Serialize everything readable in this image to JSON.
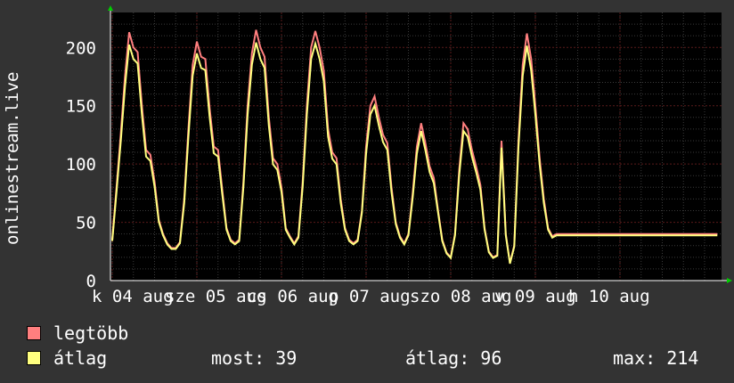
{
  "chart_data": {
    "type": "line",
    "ylabel": "onlinestream.live",
    "ylim": [
      0,
      230
    ],
    "yticks": [
      0,
      50,
      100,
      150,
      200
    ],
    "grid": true,
    "x_tick_labels": [
      "k 04 aug",
      "sze 05 aug",
      "cs 06 aug",
      "p 07 aug",
      "szo 08 aug",
      "v 09 aug",
      "h 10 aug"
    ],
    "colors": {
      "background": "#333333",
      "plot": "#000000",
      "grid": "#5a1a1a",
      "max": "#ff7f7f",
      "avg": "#ffff7f",
      "axis_arrow": "#00cc00"
    },
    "series": [
      {
        "name": "legtöbb",
        "x": [
          0,
          0.05,
          0.1,
          0.15,
          0.2,
          0.25,
          0.3,
          0.35,
          0.4,
          0.45,
          0.5,
          0.55,
          0.6,
          0.65,
          0.7,
          0.75,
          0.8,
          0.85,
          0.9,
          0.95,
          1.0,
          1.05,
          1.1,
          1.15,
          1.2,
          1.25,
          1.3,
          1.35,
          1.4,
          1.45,
          1.5,
          1.55,
          1.6,
          1.65,
          1.7,
          1.75,
          1.8,
          1.85,
          1.9,
          1.95,
          2.0,
          2.05,
          2.1,
          2.15,
          2.2,
          2.25,
          2.3,
          2.35,
          2.4,
          2.45,
          2.5,
          2.55,
          2.6,
          2.65,
          2.7,
          2.75,
          2.8,
          2.85,
          2.9,
          2.95,
          3.0,
          3.05,
          3.1,
          3.15,
          3.2,
          3.25,
          3.3,
          3.35,
          3.4,
          3.45,
          3.5,
          3.55,
          3.6,
          3.65,
          3.7,
          3.75,
          3.8,
          3.85,
          3.9,
          3.95,
          4.0,
          4.05,
          4.1,
          4.15,
          4.2,
          4.25,
          4.3,
          4.35,
          4.4,
          4.45,
          4.5,
          4.55,
          4.6,
          4.65,
          4.7,
          4.75,
          4.8,
          4.85,
          4.9,
          4.95,
          5.0,
          5.05,
          5.1,
          5.15,
          5.2,
          5.25,
          5.3,
          5.35,
          5.4,
          5.45,
          5.5,
          5.55,
          5.6,
          5.65,
          5.68,
          5.7,
          5.72,
          5.75,
          5.8,
          5.85,
          5.9,
          5.95,
          6.0,
          6.05,
          6.1,
          6.15,
          6.2,
          6.25,
          6.3,
          6.35,
          6.4,
          6.45,
          6.5,
          6.55,
          6.6,
          6.65,
          6.7,
          6.75,
          6.8,
          6.85,
          6.9,
          6.95,
          7.0,
          7.05,
          7.1,
          7.15
        ],
        "values": [
          35,
          80,
          125,
          175,
          213,
          200,
          196,
          150,
          112,
          108,
          85,
          52,
          40,
          32,
          28,
          28,
          33,
          70,
          130,
          185,
          205,
          192,
          190,
          148,
          115,
          112,
          78,
          45,
          35,
          32,
          35,
          85,
          150,
          195,
          215,
          200,
          192,
          140,
          105,
          100,
          80,
          45,
          38,
          32,
          38,
          85,
          150,
          200,
          214,
          200,
          180,
          130,
          110,
          105,
          70,
          45,
          35,
          32,
          35,
          60,
          115,
          150,
          158,
          140,
          125,
          118,
          80,
          50,
          38,
          32,
          40,
          75,
          115,
          135,
          118,
          98,
          88,
          60,
          35,
          24,
          20,
          40,
          95,
          135,
          130,
          112,
          98,
          82,
          45,
          25,
          20,
          22,
          120,
          40,
          15,
          30,
          120,
          185,
          212,
          190,
          150,
          105,
          70,
          45,
          38,
          40,
          40,
          40,
          40,
          40,
          40,
          40,
          40,
          40,
          40,
          40,
          40,
          40,
          40,
          40,
          40,
          40,
          40,
          40,
          40,
          40,
          40,
          40,
          40,
          40,
          40,
          40,
          40,
          40,
          40,
          40,
          40,
          40,
          40,
          40,
          40,
          40,
          40,
          40,
          40,
          40
        ]
      },
      {
        "name": "átlag",
        "x": [],
        "values": []
      }
    ]
  },
  "legend": [
    {
      "label": "legtöbb",
      "color": "#ff7f7f"
    },
    {
      "label": "átlag",
      "color": "#ffff7f"
    }
  ],
  "stats": {
    "most": "most: 39",
    "atlag": "átlag: 96",
    "max": "max: 214"
  }
}
